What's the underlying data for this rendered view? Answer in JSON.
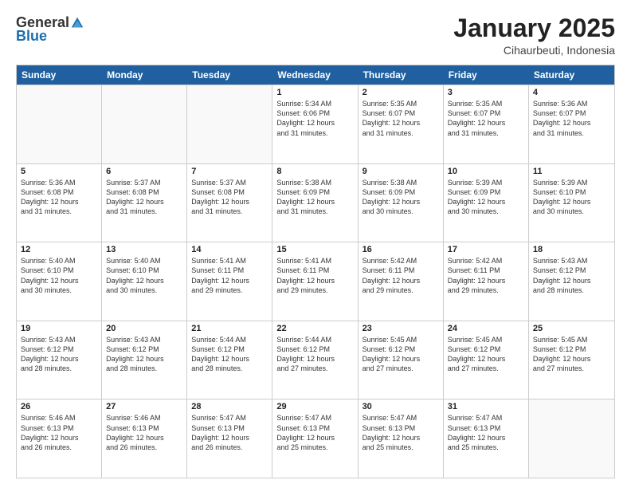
{
  "logo": {
    "general": "General",
    "blue": "Blue"
  },
  "header": {
    "month": "January 2025",
    "location": "Cihaurbeuti, Indonesia"
  },
  "weekdays": [
    "Sunday",
    "Monday",
    "Tuesday",
    "Wednesday",
    "Thursday",
    "Friday",
    "Saturday"
  ],
  "rows": [
    [
      {
        "day": "",
        "text": ""
      },
      {
        "day": "",
        "text": ""
      },
      {
        "day": "",
        "text": ""
      },
      {
        "day": "1",
        "text": "Sunrise: 5:34 AM\nSunset: 6:06 PM\nDaylight: 12 hours\nand 31 minutes."
      },
      {
        "day": "2",
        "text": "Sunrise: 5:35 AM\nSunset: 6:07 PM\nDaylight: 12 hours\nand 31 minutes."
      },
      {
        "day": "3",
        "text": "Sunrise: 5:35 AM\nSunset: 6:07 PM\nDaylight: 12 hours\nand 31 minutes."
      },
      {
        "day": "4",
        "text": "Sunrise: 5:36 AM\nSunset: 6:07 PM\nDaylight: 12 hours\nand 31 minutes."
      }
    ],
    [
      {
        "day": "5",
        "text": "Sunrise: 5:36 AM\nSunset: 6:08 PM\nDaylight: 12 hours\nand 31 minutes."
      },
      {
        "day": "6",
        "text": "Sunrise: 5:37 AM\nSunset: 6:08 PM\nDaylight: 12 hours\nand 31 minutes."
      },
      {
        "day": "7",
        "text": "Sunrise: 5:37 AM\nSunset: 6:08 PM\nDaylight: 12 hours\nand 31 minutes."
      },
      {
        "day": "8",
        "text": "Sunrise: 5:38 AM\nSunset: 6:09 PM\nDaylight: 12 hours\nand 31 minutes."
      },
      {
        "day": "9",
        "text": "Sunrise: 5:38 AM\nSunset: 6:09 PM\nDaylight: 12 hours\nand 30 minutes."
      },
      {
        "day": "10",
        "text": "Sunrise: 5:39 AM\nSunset: 6:09 PM\nDaylight: 12 hours\nand 30 minutes."
      },
      {
        "day": "11",
        "text": "Sunrise: 5:39 AM\nSunset: 6:10 PM\nDaylight: 12 hours\nand 30 minutes."
      }
    ],
    [
      {
        "day": "12",
        "text": "Sunrise: 5:40 AM\nSunset: 6:10 PM\nDaylight: 12 hours\nand 30 minutes."
      },
      {
        "day": "13",
        "text": "Sunrise: 5:40 AM\nSunset: 6:10 PM\nDaylight: 12 hours\nand 30 minutes."
      },
      {
        "day": "14",
        "text": "Sunrise: 5:41 AM\nSunset: 6:11 PM\nDaylight: 12 hours\nand 29 minutes."
      },
      {
        "day": "15",
        "text": "Sunrise: 5:41 AM\nSunset: 6:11 PM\nDaylight: 12 hours\nand 29 minutes."
      },
      {
        "day": "16",
        "text": "Sunrise: 5:42 AM\nSunset: 6:11 PM\nDaylight: 12 hours\nand 29 minutes."
      },
      {
        "day": "17",
        "text": "Sunrise: 5:42 AM\nSunset: 6:11 PM\nDaylight: 12 hours\nand 29 minutes."
      },
      {
        "day": "18",
        "text": "Sunrise: 5:43 AM\nSunset: 6:12 PM\nDaylight: 12 hours\nand 28 minutes."
      }
    ],
    [
      {
        "day": "19",
        "text": "Sunrise: 5:43 AM\nSunset: 6:12 PM\nDaylight: 12 hours\nand 28 minutes."
      },
      {
        "day": "20",
        "text": "Sunrise: 5:43 AM\nSunset: 6:12 PM\nDaylight: 12 hours\nand 28 minutes."
      },
      {
        "day": "21",
        "text": "Sunrise: 5:44 AM\nSunset: 6:12 PM\nDaylight: 12 hours\nand 28 minutes."
      },
      {
        "day": "22",
        "text": "Sunrise: 5:44 AM\nSunset: 6:12 PM\nDaylight: 12 hours\nand 27 minutes."
      },
      {
        "day": "23",
        "text": "Sunrise: 5:45 AM\nSunset: 6:12 PM\nDaylight: 12 hours\nand 27 minutes."
      },
      {
        "day": "24",
        "text": "Sunrise: 5:45 AM\nSunset: 6:12 PM\nDaylight: 12 hours\nand 27 minutes."
      },
      {
        "day": "25",
        "text": "Sunrise: 5:45 AM\nSunset: 6:12 PM\nDaylight: 12 hours\nand 27 minutes."
      }
    ],
    [
      {
        "day": "26",
        "text": "Sunrise: 5:46 AM\nSunset: 6:13 PM\nDaylight: 12 hours\nand 26 minutes."
      },
      {
        "day": "27",
        "text": "Sunrise: 5:46 AM\nSunset: 6:13 PM\nDaylight: 12 hours\nand 26 minutes."
      },
      {
        "day": "28",
        "text": "Sunrise: 5:47 AM\nSunset: 6:13 PM\nDaylight: 12 hours\nand 26 minutes."
      },
      {
        "day": "29",
        "text": "Sunrise: 5:47 AM\nSunset: 6:13 PM\nDaylight: 12 hours\nand 25 minutes."
      },
      {
        "day": "30",
        "text": "Sunrise: 5:47 AM\nSunset: 6:13 PM\nDaylight: 12 hours\nand 25 minutes."
      },
      {
        "day": "31",
        "text": "Sunrise: 5:47 AM\nSunset: 6:13 PM\nDaylight: 12 hours\nand 25 minutes."
      },
      {
        "day": "",
        "text": ""
      }
    ]
  ]
}
